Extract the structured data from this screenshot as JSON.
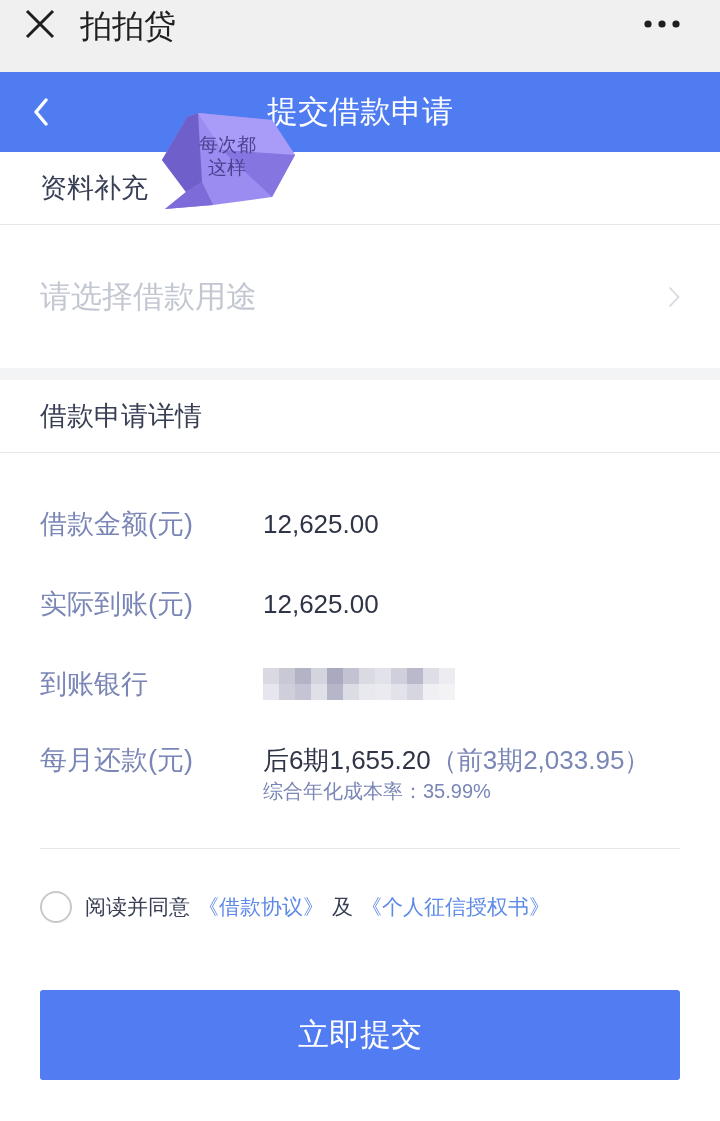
{
  "app_bar": {
    "title": "拍拍贷"
  },
  "header": {
    "title": "提交借款申请"
  },
  "supplement": {
    "title": "资料补充",
    "purpose": {
      "placeholder": "请选择借款用途"
    }
  },
  "details": {
    "title": "借款申请详情",
    "rows": [
      {
        "kind": "text",
        "label": "借款金额(元)",
        "value": "12,625.00"
      },
      {
        "kind": "text",
        "label": "实际到账(元)",
        "value": "12,625.00"
      },
      {
        "kind": "redacted",
        "label": "到账银行"
      },
      {
        "kind": "installment",
        "label": "每月还款(元)",
        "value": "后6期1,655.20",
        "extra": "（前3期2,033.95）",
        "note": "综合年化成本率：35.99%"
      }
    ]
  },
  "agreement": {
    "checked": false,
    "parts": [
      {
        "kind": "text",
        "text": "阅读并同意"
      },
      {
        "kind": "link",
        "text": "《借款协议》"
      },
      {
        "kind": "text",
        "text": "及"
      },
      {
        "kind": "link",
        "text": "《个人征信授权书》"
      }
    ]
  },
  "submit": {
    "label": "立即提交"
  },
  "sticker": {
    "text": "每次都这样"
  }
}
